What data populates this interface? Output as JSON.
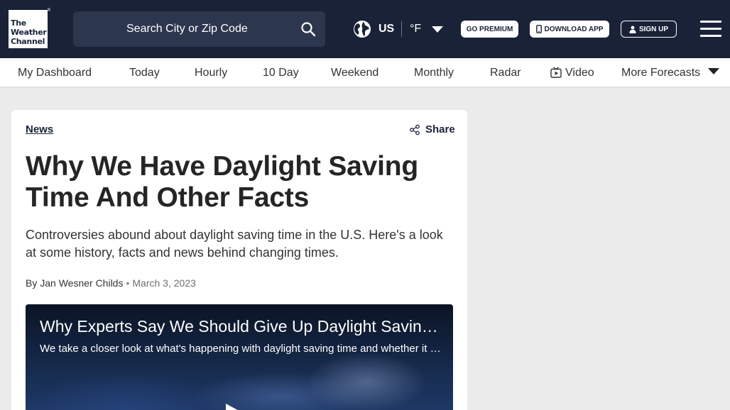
{
  "header": {
    "logo_lines": [
      "The",
      "Weather",
      "Channel"
    ],
    "search_placeholder": "Search City or Zip Code",
    "region": "US",
    "unit": "°F",
    "premium_label": "GO PREMIUM",
    "download_label": "DOWNLOAD APP",
    "signup_label": "SIGN UP",
    "icons": {
      "search": "search-icon",
      "globe": "globe-icon",
      "menu": "hamburger-menu-icon",
      "phone": "phone-icon",
      "user": "user-icon"
    },
    "background_color": "#1a2238"
  },
  "nav": {
    "items": [
      {
        "label": "My Dashboard"
      },
      {
        "label": "Today"
      },
      {
        "label": "Hourly"
      },
      {
        "label": "10 Day"
      },
      {
        "label": "Weekend"
      },
      {
        "label": "Monthly"
      },
      {
        "label": "Radar"
      },
      {
        "label": "Video"
      },
      {
        "label": "More Forecasts"
      }
    ]
  },
  "article": {
    "category": "News",
    "share_label": "Share",
    "title": "Why We Have Daylight Saving Time And Other Facts",
    "subtitle": "Controversies abound about daylight saving time in the U.S. Here's a look at some history, facts and news behind changing times.",
    "byline_prefix": "By",
    "author": "Jan Wesner Childs",
    "date": "March 3, 2023",
    "video": {
      "title": "Why Experts Say We Should Give Up Daylight Saving Time",
      "description": "We take a closer look at what's happening with daylight saving time and whether it should stay or go."
    }
  }
}
